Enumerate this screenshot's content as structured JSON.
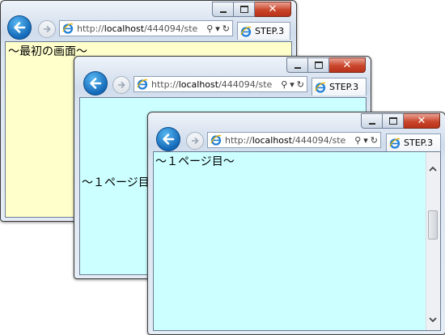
{
  "windows": [
    {
      "address": {
        "host_prefix": "http://",
        "host": "localhost",
        "path": "/444094/ste"
      },
      "tab": {
        "label": "STEP.3"
      },
      "content": {
        "text": "～最初の画面～",
        "background": "#ffffcc"
      }
    },
    {
      "address": {
        "host_prefix": "http://",
        "host": "localhost",
        "path": "/444094/ste"
      },
      "tab": {
        "label": "STEP.3"
      },
      "content": {
        "text": "～１ページ目",
        "background": "#ccffff"
      }
    },
    {
      "address": {
        "host_prefix": "http://",
        "host": "localhost",
        "path": "/444094/ste"
      },
      "tab": {
        "label": "STEP.3"
      },
      "content": {
        "text": "～１ページ目～",
        "background": "#ccffff"
      }
    }
  ],
  "icons": {
    "back": "back-arrow-icon",
    "forward": "forward-arrow-icon",
    "page": "ie-logo-icon",
    "search": "search-icon",
    "dropdown": "chevron-down-icon",
    "refresh": "refresh-icon"
  },
  "colors": {
    "close_button": "#c9452a",
    "back_button": "#1469b8"
  }
}
